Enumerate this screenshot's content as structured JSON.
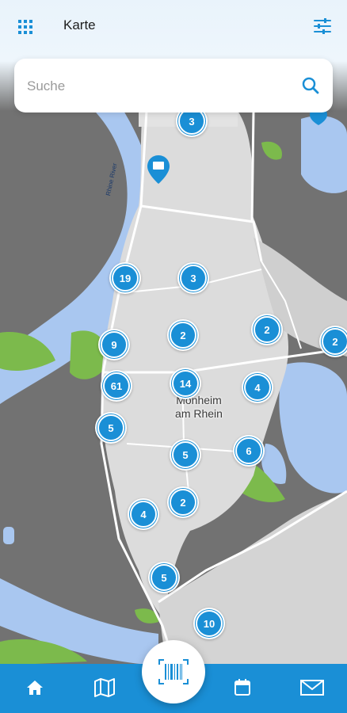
{
  "header": {
    "title": "Karte",
    "menu_icon": "grid-menu-icon",
    "filter_icon": "filter-sliders-icon"
  },
  "search": {
    "placeholder": "Suche",
    "value": "",
    "icon": "search-icon"
  },
  "map": {
    "city_label_line1": "Monheim",
    "city_label_line2": "am Rhein",
    "river_label": "Rhine River",
    "accent_color": "#1a8fd6",
    "clusters": [
      {
        "id": "c1",
        "count": "3"
      },
      {
        "id": "c2",
        "count": "19"
      },
      {
        "id": "c3",
        "count": "3"
      },
      {
        "id": "c4",
        "count": "9"
      },
      {
        "id": "c5",
        "count": "2"
      },
      {
        "id": "c6",
        "count": "2"
      },
      {
        "id": "c7",
        "count": "2"
      },
      {
        "id": "c8",
        "count": "61"
      },
      {
        "id": "c9",
        "count": "14"
      },
      {
        "id": "c10",
        "count": "4"
      },
      {
        "id": "c11",
        "count": "5"
      },
      {
        "id": "c12",
        "count": "5"
      },
      {
        "id": "c13",
        "count": "6"
      },
      {
        "id": "c14",
        "count": "2"
      },
      {
        "id": "c15",
        "count": "4"
      },
      {
        "id": "c16",
        "count": "5"
      },
      {
        "id": "c17",
        "count": "10"
      }
    ]
  },
  "bottom_nav": {
    "items": [
      {
        "name": "home",
        "icon": "home-icon"
      },
      {
        "name": "map",
        "icon": "map-icon"
      },
      {
        "name": "scan",
        "icon": "barcode-scan-icon"
      },
      {
        "name": "calendar",
        "icon": "calendar-icon"
      },
      {
        "name": "mail",
        "icon": "mail-icon"
      }
    ],
    "background": "#1a8fd6"
  }
}
